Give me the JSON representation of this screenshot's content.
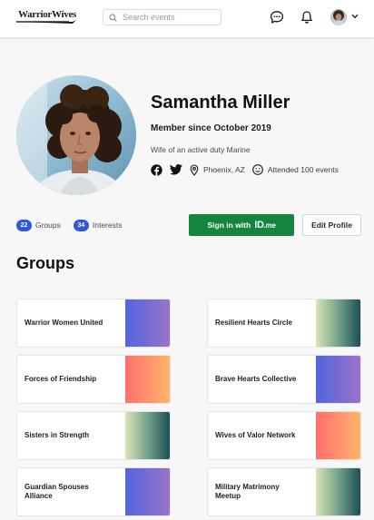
{
  "header": {
    "logo_text": "WarriorWives",
    "search_placeholder": "Search events",
    "icons": [
      "chat-icon",
      "bell-icon",
      "avatar",
      "chevron-down-icon"
    ]
  },
  "profile": {
    "name": "Samantha Miller",
    "member_since": "Member since October 2019",
    "bio": "Wife of an active duty Marine",
    "location": "Phoenix, AZ",
    "events": "Attended 100 events",
    "social": [
      "facebook-icon",
      "twitter-icon"
    ]
  },
  "stats": {
    "groups_count": "22",
    "groups_label": "Groups",
    "interests_count": "34",
    "interests_label": "Interests"
  },
  "actions": {
    "idme_prefix": "Sign in with",
    "idme_brand": "ID",
    "idme_suffix": ".me",
    "edit_label": "Edit Profile"
  },
  "groups_title": "Groups",
  "groups": [
    {
      "name": "Warrior Women United",
      "thumb": "blue"
    },
    {
      "name": "Resilient Hearts Circle",
      "thumb": "teal"
    },
    {
      "name": "Forces of Friendship",
      "thumb": "warm"
    },
    {
      "name": "Brave Hearts Collective",
      "thumb": "blue"
    },
    {
      "name": "Sisters in Strength",
      "thumb": "teal"
    },
    {
      "name": "Wives of Valor Network",
      "thumb": "warm"
    },
    {
      "name": "Guardian Spouses Alliance",
      "thumb": "blue"
    },
    {
      "name": "Military Matrimony Meetup",
      "thumb": "teal"
    }
  ],
  "colors": {
    "accent_blue": "#2f57d9",
    "idme_green": "#13853f",
    "gradient_blue": [
      "#5165de",
      "#9d72c8"
    ],
    "gradient_teal": [
      "#d8e6b6",
      "#1d4e57"
    ],
    "gradient_warm": [
      "#ff6f6f",
      "#ffb46a"
    ]
  }
}
